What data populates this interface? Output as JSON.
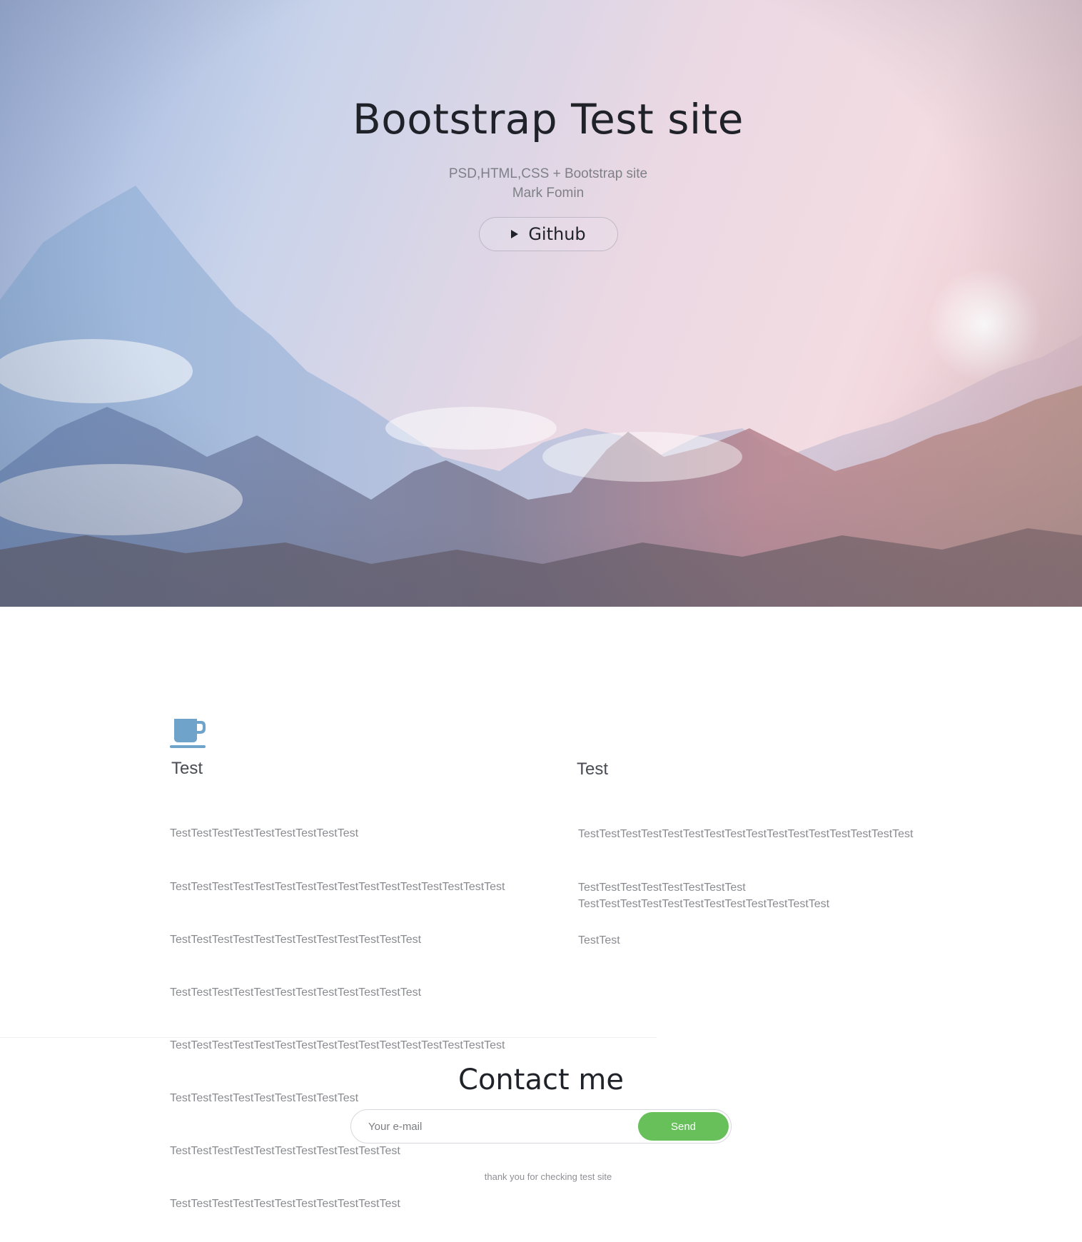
{
  "hero": {
    "title": "Bootstrap Test site",
    "subtitle_line1": "PSD,HTML,CSS + Bootstrap site",
    "subtitle_line2": "Mark Fomin",
    "github_label": "Github",
    "github_icon": "play-icon"
  },
  "features": {
    "left": {
      "icon": "coffee-cup-icon",
      "title": "Test",
      "lines": [
        "TestTestTestTestTestTestTestTestTest",
        "TestTestTestTestTestTestTestTestTestTestTestTestTestTestTestTest",
        "TestTestTestTestTestTestTestTestTestTestTestTest",
        "TestTestTestTestTestTestTestTestTestTestTestTest",
        "TestTestTestTestTestTestTestTestTestTestTestTestTestTestTestTest",
        "TestTestTestTestTestTestTestTestTest",
        "TestTestTestTestTestTestTestTestTestTestTest",
        "TestTestTestTestTestTestTestTestTestTestTest"
      ]
    },
    "right": {
      "title": "Test",
      "lines": [
        "TestTestTestTestTestTestTestTestTestTestTestTestTestTestTestTest",
        "TestTestTestTestTestTestTestTest",
        "TestTest"
      ],
      "lines2": [
        "TestTestTestTestTestTestTestTestTestTestTestTest"
      ]
    }
  },
  "contact": {
    "title": "Contact me",
    "email_placeholder": "Your e-mail",
    "send_label": "Send",
    "footer_note": "thank you for checking test site"
  },
  "colors": {
    "accent_green": "#67c05a",
    "cup_blue": "#6fa3c9",
    "title_dark": "#1f2229",
    "body_gray": "#8a8b90"
  }
}
